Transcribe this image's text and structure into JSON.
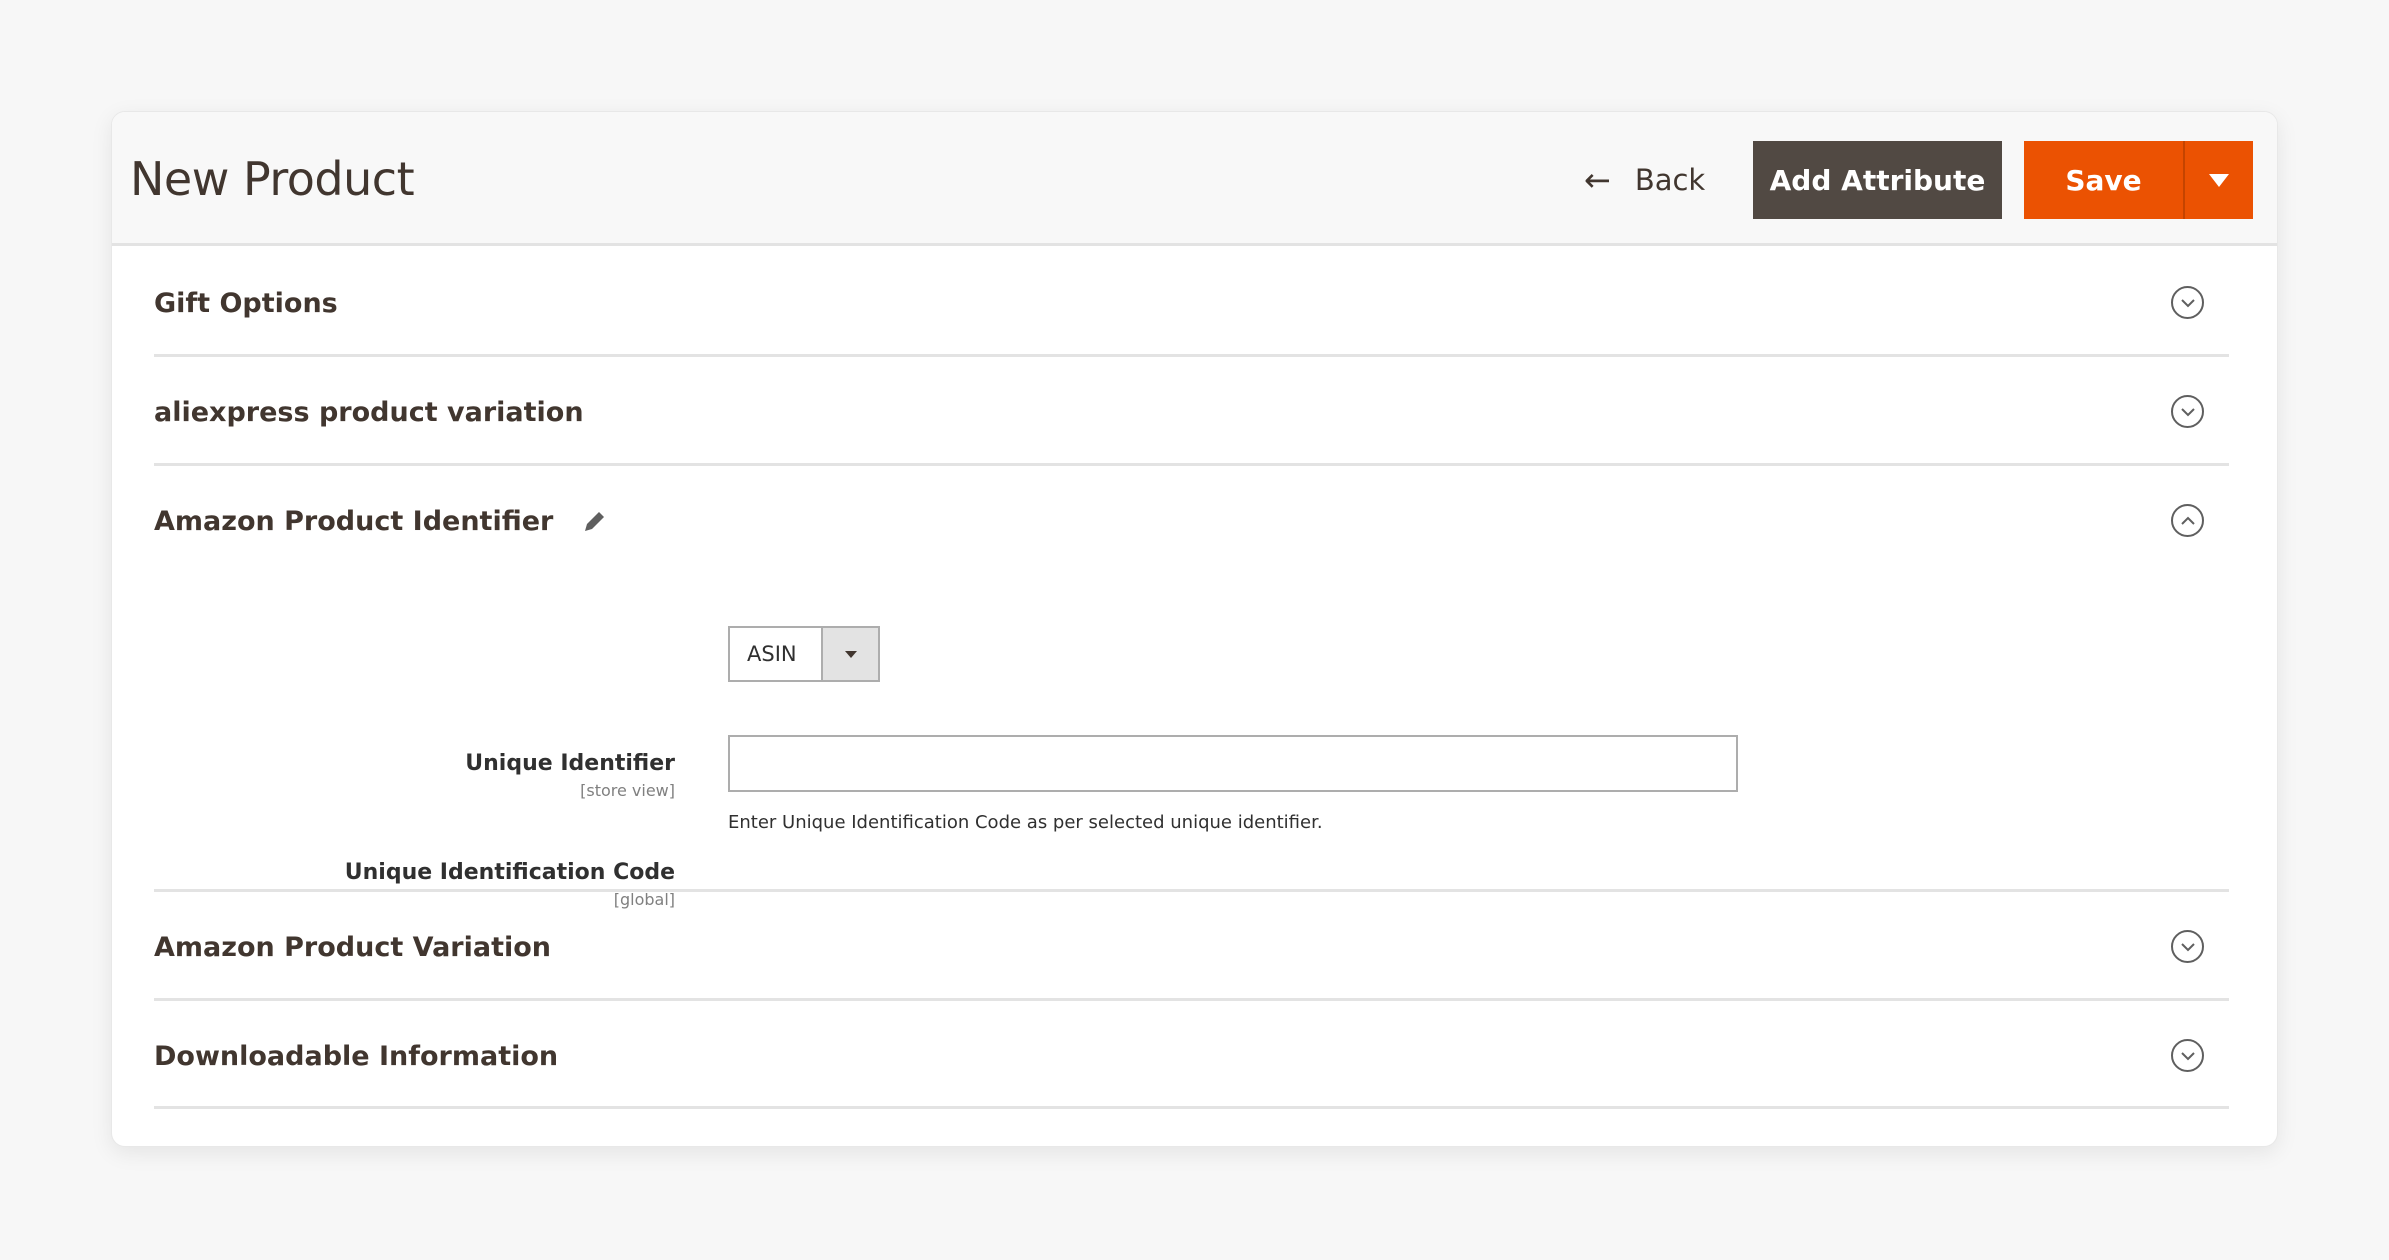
{
  "header": {
    "title": "New Product",
    "back_label": "Back",
    "add_attribute_label": "Add Attribute",
    "save_label": "Save"
  },
  "colors": {
    "primary": "#eb5202",
    "secondary": "#514943",
    "text": "#41362f"
  },
  "sections": [
    {
      "title": "Gift Options",
      "state": "collapsed",
      "icon": "chevron-down-circle-icon"
    },
    {
      "title": "aliexpress product variation",
      "state": "collapsed",
      "icon": "chevron-down-circle-icon"
    },
    {
      "title": "Amazon Product Identifier",
      "state": "expanded",
      "icon": "chevron-up-circle-icon",
      "edit_icon": "pencil-icon"
    },
    {
      "title": "Amazon Product Variation",
      "state": "collapsed",
      "icon": "chevron-down-circle-icon"
    },
    {
      "title": "Downloadable Information",
      "state": "collapsed",
      "icon": "chevron-down-circle-icon"
    }
  ],
  "amazon_identifier_form": {
    "unique_identifier": {
      "label": "Unique Identifier",
      "scope": "[store view]",
      "selected": "ASIN"
    },
    "unique_identification_code": {
      "label": "Unique Identification Code",
      "scope": "[global]",
      "value": "",
      "placeholder": "",
      "note": "Enter Unique Identification Code as per selected unique identifier."
    }
  }
}
